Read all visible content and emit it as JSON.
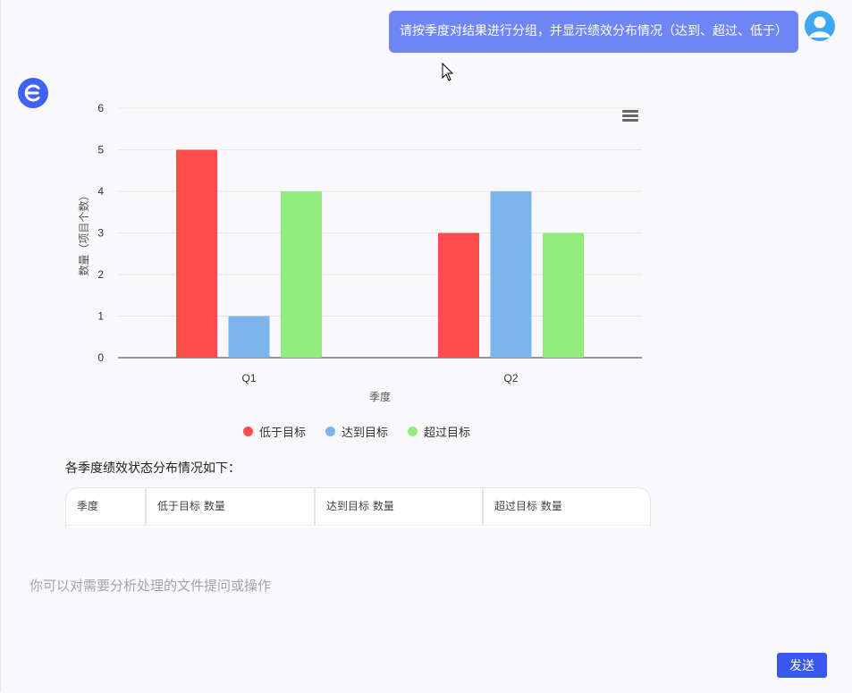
{
  "user_message": "请按季度对结果进行分组，并显示绩效分布情况（达到、超过、低于）",
  "assistant": {
    "summary": "各季度绩效状态分布情况如下："
  },
  "colors": {
    "below": "#ff4d4f",
    "meet": "#7cb5ec",
    "exceed": "#90ed7d",
    "accent": "#3a57f0",
    "user_bubble": "#6f86f5"
  },
  "chart_data": {
    "type": "bar",
    "categories": [
      "Q1",
      "Q2"
    ],
    "series": [
      {
        "name": "低于目标",
        "values": [
          5,
          3
        ]
      },
      {
        "name": "达到目标",
        "values": [
          1,
          4
        ]
      },
      {
        "name": "超过目标",
        "values": [
          4,
          3
        ]
      }
    ],
    "xlabel": "季度",
    "ylabel": "数量（项目个数）",
    "ylim": [
      0,
      6
    ],
    "yticks": [
      0,
      1,
      2,
      3,
      4,
      5,
      6
    ],
    "grid": true,
    "legend_position": "bottom"
  },
  "table": {
    "headers": [
      "季度",
      "低于目标 数量",
      "达到目标 数量",
      "超过目标 数量"
    ]
  },
  "input": {
    "placeholder": "你可以对需要分析处理的文件提问或操作"
  },
  "send_label": "发送",
  "icons": {
    "user_avatar": "user-avatar-icon",
    "bot_avatar": "bot-logo-icon",
    "chart_menu": "hamburger-menu-icon",
    "cursor": "mouse-cursor-icon"
  }
}
